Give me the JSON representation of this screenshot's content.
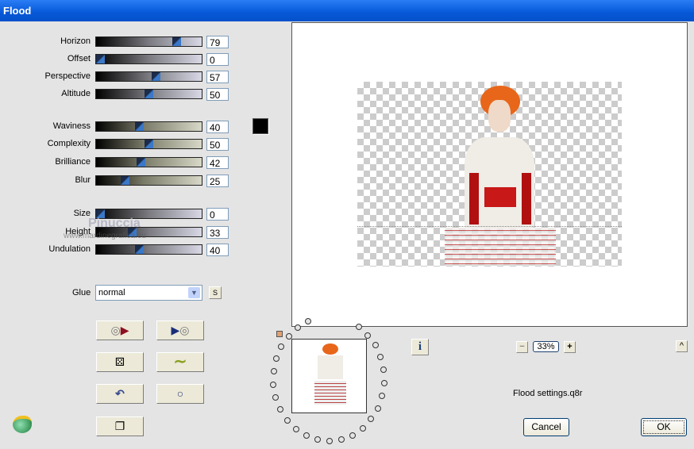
{
  "window": {
    "title": "Flood"
  },
  "sliders": [
    {
      "label": "Horizon",
      "value": 79,
      "group": 1
    },
    {
      "label": "Offset",
      "value": 0,
      "group": 1
    },
    {
      "label": "Perspective",
      "value": 57,
      "group": 1
    },
    {
      "label": "Altitude",
      "value": 50,
      "group": 1
    },
    {
      "label": "Waviness",
      "value": 40,
      "group": 2
    },
    {
      "label": "Complexity",
      "value": 50,
      "group": 2
    },
    {
      "label": "Brilliance",
      "value": 42,
      "group": 2
    },
    {
      "label": "Blur",
      "value": 25,
      "group": 2
    },
    {
      "label": "Size",
      "value": 0,
      "group": 3
    },
    {
      "label": "Height",
      "value": 33,
      "group": 3
    },
    {
      "label": "Undulation",
      "value": 40,
      "group": 3
    }
  ],
  "color_swatch": "#000000",
  "glue": {
    "label": "Glue",
    "value": "normal",
    "s_button": "S"
  },
  "watermark": {
    "name": "Pinuccia",
    "url": "www.mardinegrafica.eu"
  },
  "zoom": {
    "minus": "−",
    "value": "33%",
    "plus": "+",
    "collapse": "^"
  },
  "info_icon": "i",
  "settings_file": "Flood settings.q8r",
  "buttons": {
    "cancel": "Cancel",
    "ok": "OK"
  }
}
